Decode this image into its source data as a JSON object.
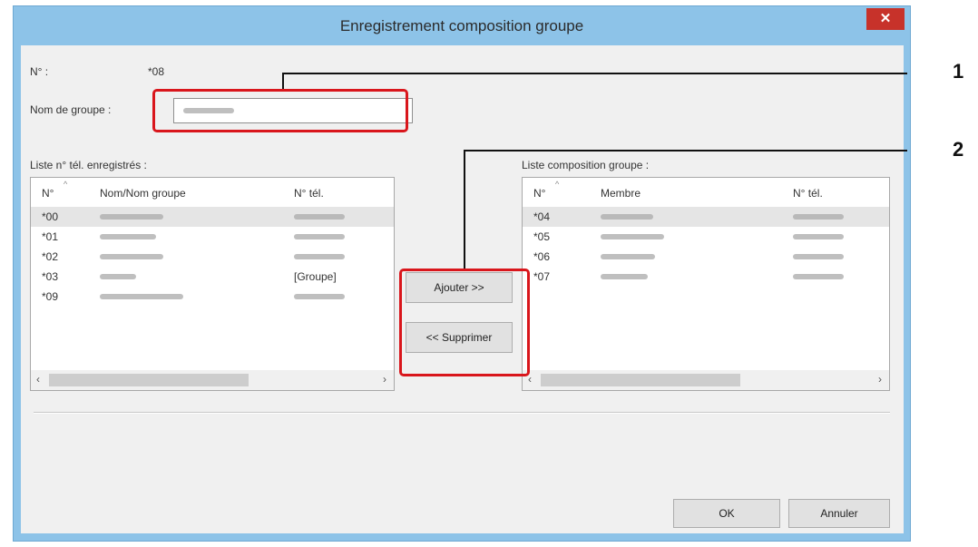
{
  "window": {
    "title": "Enregistrement composition groupe",
    "close_symbol": "✕"
  },
  "form": {
    "number_label": "N° :",
    "number_value": "*08",
    "group_name_label": "Nom de groupe :"
  },
  "left_list": {
    "label": "Liste n° tél. enregistrés :",
    "columns": [
      "N°",
      "Nom/Nom groupe",
      "N° tél."
    ],
    "rows": [
      {
        "no": "*00",
        "tel": ""
      },
      {
        "no": "*01",
        "tel": ""
      },
      {
        "no": "*02",
        "tel": ""
      },
      {
        "no": "*03",
        "tel": "[Groupe]"
      },
      {
        "no": "*09",
        "tel": ""
      }
    ]
  },
  "right_list": {
    "label": "Liste composition groupe :",
    "columns": [
      "N°",
      "Membre",
      "N° tél."
    ],
    "rows": [
      {
        "no": "*04"
      },
      {
        "no": "*05"
      },
      {
        "no": "*06"
      },
      {
        "no": "*07"
      }
    ]
  },
  "buttons": {
    "add": "Ajouter >>",
    "remove": "<< Supprimer",
    "ok": "OK",
    "cancel": "Annuler"
  },
  "callouts": {
    "one": "1",
    "two": "2"
  },
  "colors": {
    "title_bar": "#8dc3e8",
    "close": "#c7322a",
    "highlight": "#d9161c"
  },
  "scroll": {
    "left": "‹",
    "right": "›"
  }
}
